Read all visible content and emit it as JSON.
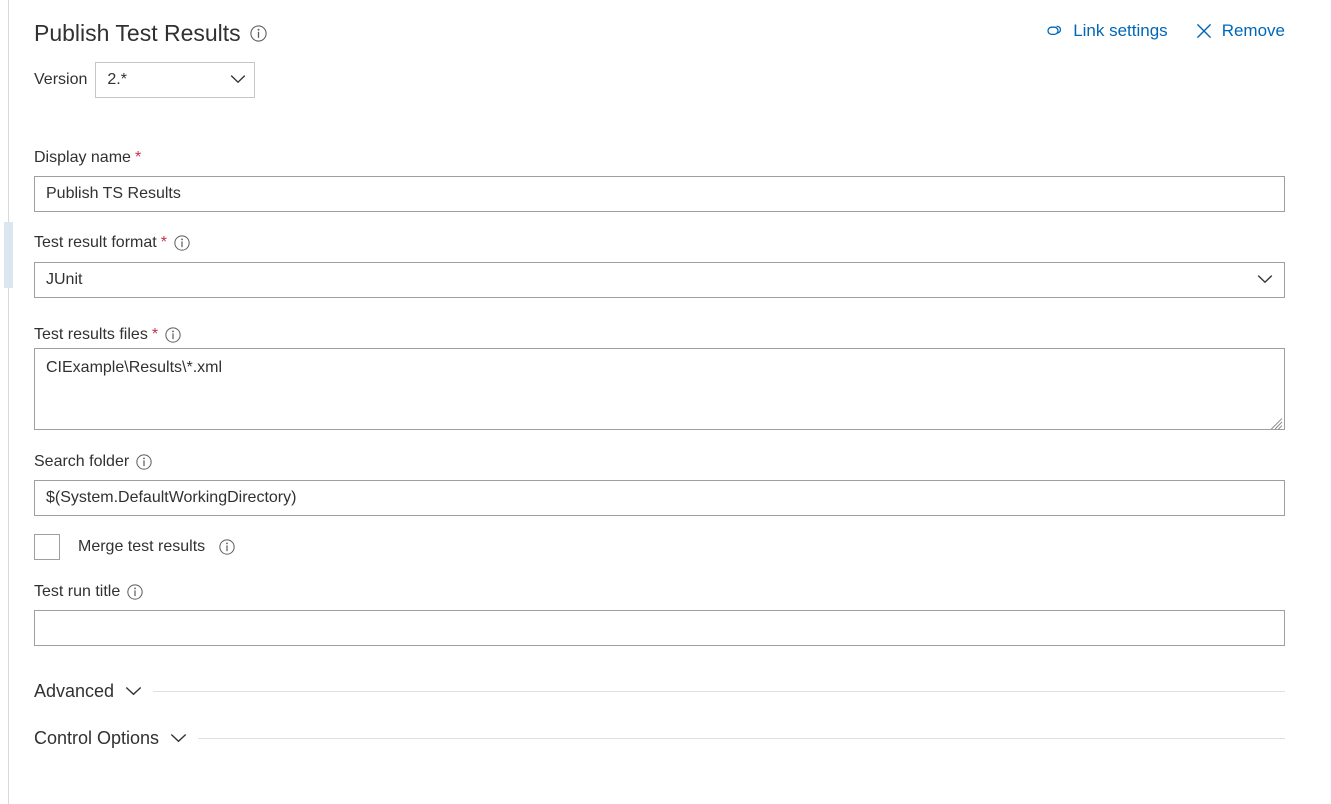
{
  "header": {
    "title": "Publish Test Results",
    "info_icon": "info-circle-icon",
    "link_settings_label": "Link settings",
    "link_settings_icon": "link-chain-icon",
    "remove_label": "Remove",
    "remove_icon": "close-x-icon",
    "accent_color": "#0067b8"
  },
  "version": {
    "label": "Version",
    "value": "2.*",
    "chevron_icon": "chevron-down-icon"
  },
  "fields": {
    "display_name": {
      "label": "Display name",
      "required_marker": "*",
      "value": "Publish TS Results"
    },
    "test_result_format": {
      "label": "Test result format",
      "required_marker": "*",
      "info_icon": "info-circle-icon",
      "value": "JUnit",
      "chevron_icon": "chevron-down-icon"
    },
    "test_results_files": {
      "label": "Test results files",
      "required_marker": "*",
      "info_icon": "info-circle-icon",
      "value": "CIExample\\Results\\*.xml"
    },
    "search_folder": {
      "label": "Search folder",
      "info_icon": "info-circle-icon",
      "value": "$(System.DefaultWorkingDirectory)"
    },
    "merge_test_results": {
      "label": "Merge test results",
      "info_icon": "info-circle-icon",
      "checked": false
    },
    "test_run_title": {
      "label": "Test run title",
      "info_icon": "info-circle-icon",
      "value": ""
    }
  },
  "sections": [
    {
      "label": "Advanced",
      "chevron_icon": "chevron-down-icon",
      "expanded": false
    },
    {
      "label": "Control Options",
      "chevron_icon": "chevron-down-icon",
      "expanded": false
    }
  ],
  "colors": {
    "required_asterisk": "#c4314b",
    "text": "#323130",
    "border": "#a19f9d",
    "divider": "#e1dfdd"
  }
}
